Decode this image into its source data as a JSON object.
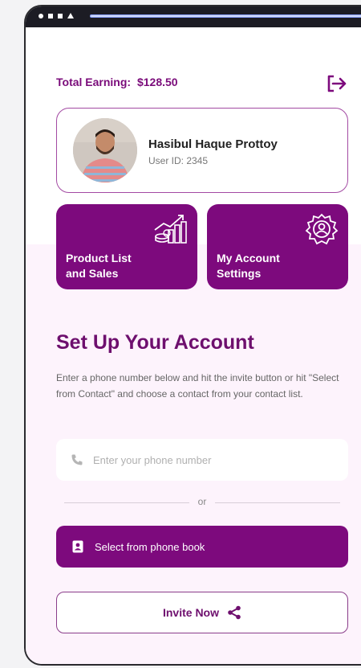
{
  "header": {
    "earning_label": "Total Earning:",
    "earning_amount": "$128.50",
    "logout_icon": "logout-icon"
  },
  "profile": {
    "name": "Hasibul Haque Prottoy",
    "user_id": "User ID: 2345"
  },
  "tiles": [
    {
      "label": "Product List\nand Sales",
      "icon": "sales-chart-icon"
    },
    {
      "label": "My Account\nSettings",
      "icon": "account-settings-icon"
    }
  ],
  "setup": {
    "title": "Set Up Your Account",
    "description": "Enter a phone number below and hit the invite button or hit \"Select from Contact\" and choose a contact from your contact list.",
    "phone_placeholder": "Enter your phone number",
    "or_text": "or",
    "phonebook_label": "Select from phone book",
    "invite_label": "Invite Now"
  },
  "colors": {
    "brand": "#7d0a7d",
    "title": "#6e0f6e",
    "background_tint": "#fdf3fc"
  }
}
